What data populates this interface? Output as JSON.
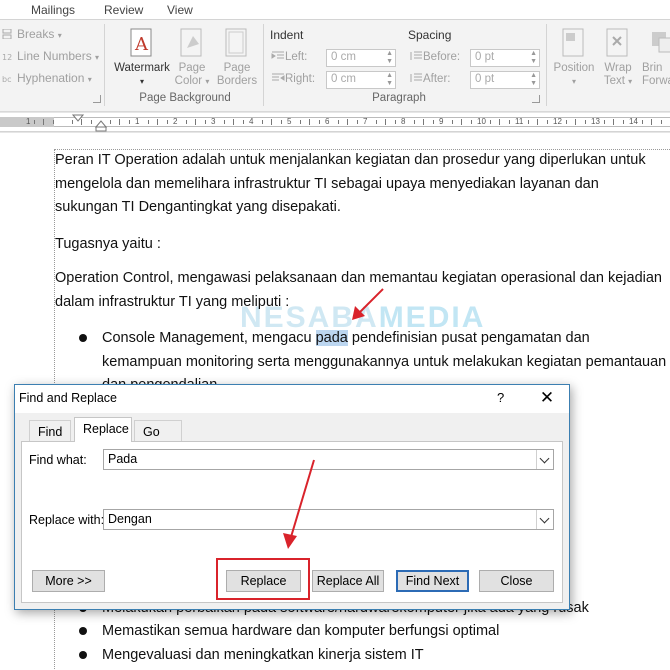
{
  "ribbon": {
    "tabs": [
      "Mailings",
      "Review",
      "View"
    ],
    "page_setup": {
      "breaks": "Breaks",
      "line_numbers": "Line Numbers",
      "hyphenation": "Hyphenation"
    },
    "page_background": {
      "group_label": "Page Background",
      "watermark": "Watermark",
      "page_color": "Page Color",
      "page_color_l1": "Page",
      "page_color_l2": "Color",
      "page_borders_l1": "Page",
      "page_borders_l2": "Borders"
    },
    "paragraph": {
      "group_label": "Paragraph",
      "indent_title": "Indent",
      "left_label": "Left:",
      "left_value": "0 cm",
      "right_label": "Right:",
      "right_value": "0 cm",
      "spacing_title": "Spacing",
      "before_label": "Before:",
      "before_value": "0 pt",
      "after_label": "After:",
      "after_value": "0 pt"
    },
    "arrange": {
      "position": "Position",
      "wrap_l1": "Wrap",
      "wrap_l2": "Text",
      "bring_l1": "Brin",
      "bring_l2": "Forwa"
    }
  },
  "ruler": {
    "numbers": [
      "1",
      "2",
      "3",
      "4",
      "5",
      "6",
      "7",
      "8",
      "9",
      "10",
      "11",
      "12",
      "13",
      "14"
    ]
  },
  "document": {
    "p1": "Peran IT Operation adalah untuk menjalankan kegiatan dan prosedur yang diperlukan untuk mengelola dan memelihara infrastruktur TI sebagai upaya menyediakan layanan dan sukungan TI Dengantingkat yang disepakati.",
    "p2": "Tugasnya yaitu :",
    "p3": "Operation Control, mengawasi pelaksanaan dan memantau kegiatan operasional dan kejadian dalam infrastruktur TI yang meliputi :",
    "b1_pre": "Console Management, mengacu ",
    "b1_hl": "pada",
    "b1_post": " pendefinisian pusat pengamatan dan kemampuan monitoring serta menggunakannya untuk melakukan kegiatan pemantauan dan pengendalian",
    "b_partial": "Melakukan perbaikan pada software/hardwarekomputer  jika ada yang rusak",
    "b_2": "Memastikan semua hardware dan komputer berfungsi optimal",
    "b_3": "Mengevaluasi dan meningkatkan kinerja sistem IT",
    "watermark_a": "NESABA",
    "watermark_b": "MEDIA"
  },
  "dialog": {
    "title": "Find and Replace",
    "help": "?",
    "close": "✕",
    "tabs": {
      "find": "Find",
      "replace": "Replace",
      "goto": "Go To"
    },
    "find_label": "Find what:",
    "find_value": "Pada",
    "replace_label": "Replace with:",
    "replace_value": "Dengan",
    "buttons": {
      "more": "More >>",
      "replace": "Replace",
      "replace_all": "Replace All",
      "find_next": "Find Next",
      "close": "Close"
    }
  },
  "colors": {
    "highlight": "#bcd6f0",
    "annotation_red": "#d9232b",
    "dialog_border": "#3c7fb1"
  }
}
